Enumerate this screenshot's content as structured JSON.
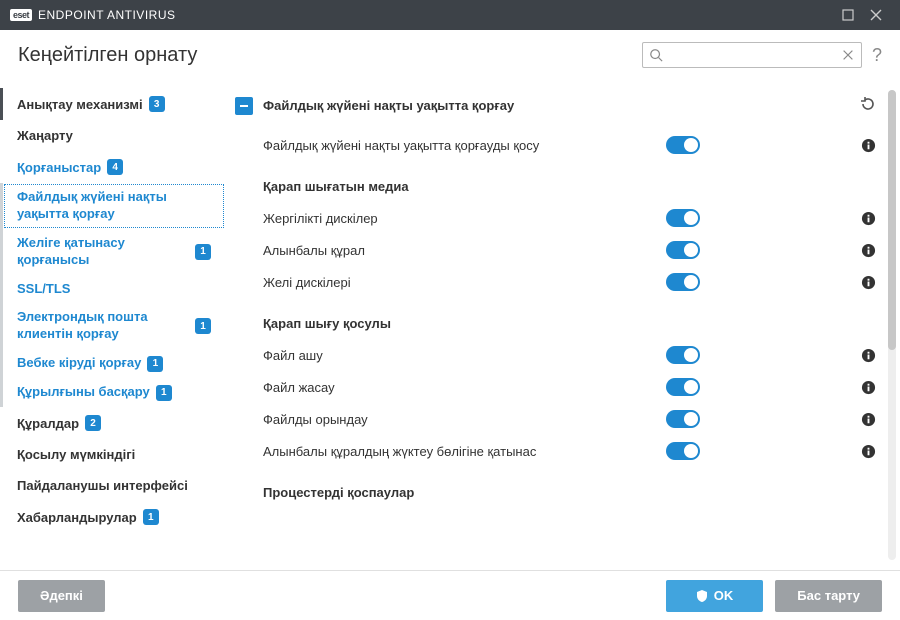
{
  "titlebar": {
    "brand": "eset",
    "product": "ENDPOINT ANTIVIRUS"
  },
  "header": {
    "title": "Кеңейтілген орнату",
    "search_placeholder": "",
    "help": "?"
  },
  "sidebar": {
    "items": [
      {
        "label": "Анықтау механизмі",
        "badge": "3"
      },
      {
        "label": "Жаңарту"
      },
      {
        "label": "Қорғаныстар",
        "badge": "4",
        "expanded": true
      },
      {
        "label": "Құралдар",
        "badge": "2"
      },
      {
        "label": "Қосылу мүмкіндігі"
      },
      {
        "label": "Пайдаланушы интерфейсі"
      },
      {
        "label": "Хабарландырулар",
        "badge": "1"
      }
    ],
    "subitems": [
      {
        "label": "Файлдық жүйені нақты уақытта қорғау",
        "selected": true
      },
      {
        "label": "Желіге қатынасу қорғанысы",
        "badge": "1"
      },
      {
        "label": "SSL/TLS"
      },
      {
        "label": "Электрондық пошта клиентін қорғау",
        "badge": "1"
      },
      {
        "label": "Вебке кіруді қорғау",
        "badge": "1"
      },
      {
        "label": "Құрылғыны басқару",
        "badge": "1"
      }
    ]
  },
  "main": {
    "section_title": "Файлдық жүйені нақты уақытта қорғау",
    "enable_row": "Файлдық жүйені нақты уақытта қорғауды қосу",
    "group_media": "Қарап шығатын медиа",
    "media_rows": [
      "Жергілікті дискілер",
      "Алынбалы құрал",
      "Желі дискілері"
    ],
    "group_scan": "Қарап шығу қосулы",
    "scan_rows": [
      "Файл ашу",
      "Файл жасау",
      "Файлды орындау",
      "Алынбалы құралдың жүктеу бөлігіне қатынас"
    ],
    "group_proc": "Процестерді қоспаулар"
  },
  "footer": {
    "default": "Әдепкі",
    "ok": "OK",
    "cancel": "Бас тарту"
  }
}
